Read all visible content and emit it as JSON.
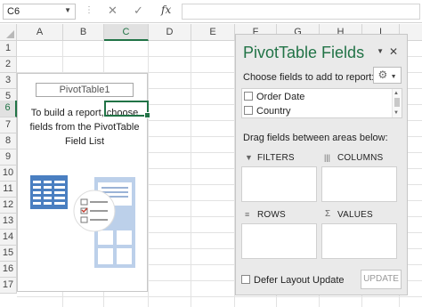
{
  "formula_bar": {
    "name_box": "C6",
    "cancel_icon": "✕",
    "enter_icon": "✓",
    "fx_label": "fx",
    "formula": ""
  },
  "columns": [
    "A",
    "B",
    "C",
    "D",
    "E",
    "F",
    "G",
    "H",
    "I"
  ],
  "selected_column": "C",
  "rows": [
    "1",
    "2",
    "3",
    "4",
    "5",
    "6",
    "7",
    "8",
    "9",
    "10",
    "11",
    "12",
    "13",
    "14",
    "15",
    "16",
    "17"
  ],
  "selected_row": "6",
  "pivot_placeholder": {
    "name": "PivotTable1",
    "instruction_line1": "To build a report, choose",
    "instruction_line2": "fields from the PivotTable",
    "instruction_line3": "Field List"
  },
  "pivot_panel": {
    "title": "PivotTable Fields",
    "choose_label": "Choose fields to add to report:",
    "fields": [
      {
        "label": "Order Date",
        "checked": false
      },
      {
        "label": "Country",
        "checked": false
      }
    ],
    "drag_label": "Drag fields between areas below:",
    "areas": {
      "filters": "FILTERS",
      "columns": "COLUMNS",
      "rows": "ROWS",
      "values": "VALUES"
    },
    "defer_label": "Defer Layout Update",
    "update_button": "UPDATE"
  },
  "colors": {
    "accent": "#217346",
    "panel_bg": "#eaeaea",
    "illustration_blue": "#4a7fc1"
  }
}
